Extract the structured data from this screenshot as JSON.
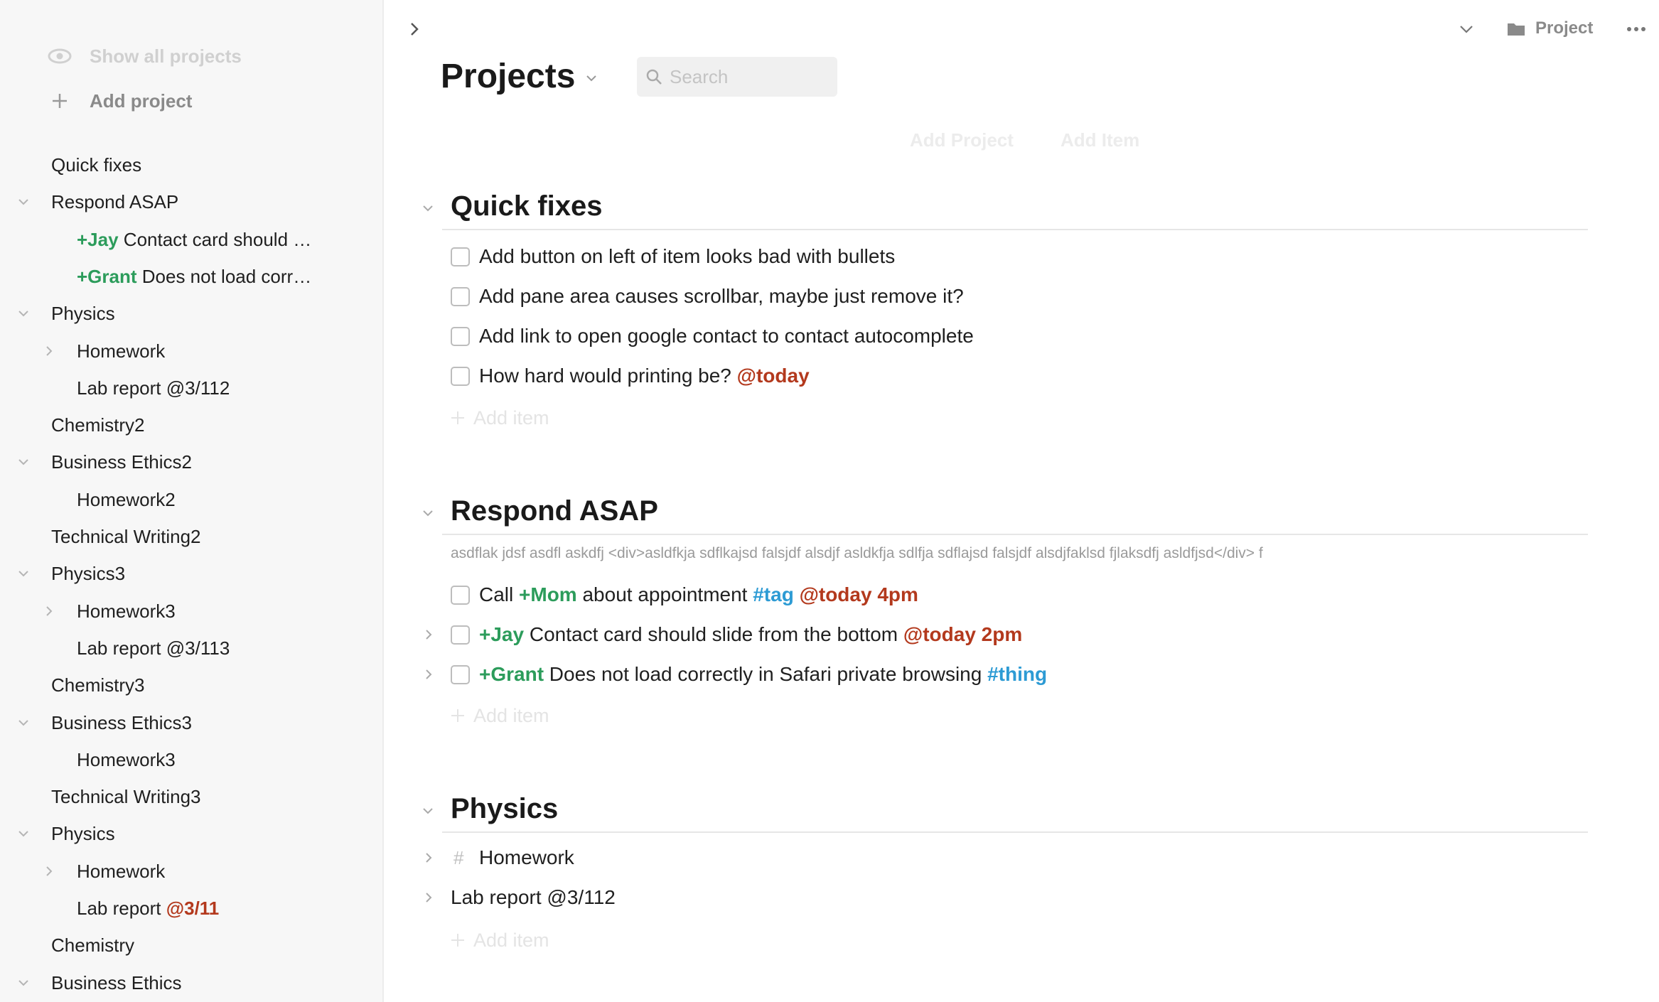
{
  "colors": {
    "mention": "#2c9c5b",
    "tag": "#2d9bd4",
    "due": "#b3391d",
    "sidebar_bg": "#f7f7f7"
  },
  "sidebar": {
    "show_all_label": "Show all projects",
    "add_project_label": "Add project",
    "items": [
      {
        "label": "Quick fixes",
        "indent": 0,
        "toggle": "none"
      },
      {
        "label": "Respond ASAP",
        "indent": 0,
        "toggle": "down"
      },
      {
        "mention": "+Jay",
        "label": " Contact card should …",
        "indent": 1,
        "toggle": "none"
      },
      {
        "mention": "+Grant",
        "label": " Does not load corr…",
        "indent": 1,
        "toggle": "none"
      },
      {
        "label": "Physics",
        "indent": 0,
        "toggle": "down"
      },
      {
        "label": "Homework",
        "indent": 1,
        "toggle": "right"
      },
      {
        "label": "Lab report @3/112",
        "indent": 1,
        "toggle": "none"
      },
      {
        "label": "Chemistry2",
        "indent": 0,
        "toggle": "none"
      },
      {
        "label": "Business Ethics2",
        "indent": 0,
        "toggle": "down"
      },
      {
        "label": "Homework2",
        "indent": 1,
        "toggle": "none"
      },
      {
        "label": "Technical Writing2",
        "indent": 0,
        "toggle": "none"
      },
      {
        "label": "Physics3",
        "indent": 0,
        "toggle": "down"
      },
      {
        "label": "Homework3",
        "indent": 1,
        "toggle": "right"
      },
      {
        "label": "Lab report @3/113",
        "indent": 1,
        "toggle": "none"
      },
      {
        "label": "Chemistry3",
        "indent": 0,
        "toggle": "none"
      },
      {
        "label": "Business Ethics3",
        "indent": 0,
        "toggle": "down"
      },
      {
        "label": "Homework3",
        "indent": 1,
        "toggle": "none"
      },
      {
        "label": "Technical Writing3",
        "indent": 0,
        "toggle": "none"
      },
      {
        "label": "Physics",
        "indent": 0,
        "toggle": "down"
      },
      {
        "label": "Homework",
        "indent": 1,
        "toggle": "right"
      },
      {
        "label": "Lab report ",
        "due": "@3/11",
        "indent": 1,
        "toggle": "none"
      },
      {
        "label": "Chemistry",
        "indent": 0,
        "toggle": "none"
      },
      {
        "label": "Business Ethics",
        "indent": 0,
        "toggle": "down"
      }
    ]
  },
  "toolbar": {
    "project_label": "Project",
    "icons": [
      "chevron-right-icon",
      "chevron-down-icon",
      "folder-icon",
      "more-icon"
    ]
  },
  "header": {
    "title": "Projects",
    "search_placeholder": "Search",
    "add_project_label": "Add Project",
    "add_item_label": "Add Item"
  },
  "add_item_label": "Add item",
  "sections": {
    "quick_fixes": {
      "title": "Quick fixes",
      "tasks": [
        {
          "text": "Add button on left of item looks bad with bullets"
        },
        {
          "text": "Add pane area causes scrollbar, maybe just remove it?"
        },
        {
          "text": "Add link to open google contact to contact autocomplete"
        },
        {
          "text": "How hard would printing be? ",
          "due": "@today"
        }
      ]
    },
    "respond_asap": {
      "title": "Respond ASAP",
      "note": "asdflak jdsf asdfl askdfj <div>asldfkja sdflkajsd falsjdf alsdjf asldkfja sdlfja sdflajsd falsjdf alsdjfaklsd fjlaksdfj asldfjsd</div> f",
      "task1": {
        "prefix": "Call ",
        "mention": "+Mom",
        "middle": " about appointment ",
        "tag": "#tag",
        "due": "@today 4pm"
      },
      "task2": {
        "mention": "+Jay",
        "text": " Contact card should slide from the bottom ",
        "due": "@today 2pm"
      },
      "task3": {
        "mention": "+Grant",
        "text": " Does not load correctly in Safari private browsing ",
        "tag": "#thing"
      }
    },
    "physics": {
      "title": "Physics",
      "homework_label": "Homework",
      "homework_prefix": "#",
      "lab_report_label": "Lab report @3/112"
    }
  }
}
